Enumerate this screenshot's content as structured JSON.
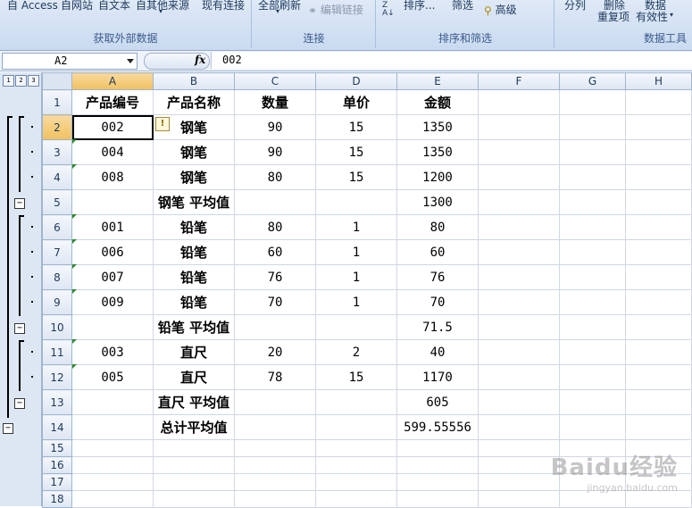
{
  "ribbon": {
    "external_data_items": [
      "自 Access",
      "自网站",
      "自文本",
      "自其他来源"
    ],
    "existing_connections": "现有连接",
    "refresh_all": "全部刷新",
    "edit_links": "编辑链接",
    "sort": "排序...",
    "filter": "筛选",
    "advanced": "高级",
    "split": "分列",
    "remove": "删除",
    "remove_dup": "重复项",
    "data": "数据",
    "validity": "有效性",
    "group_external": "获取外部数据",
    "group_connections": "连接",
    "group_sort_filter": "排序和筛选",
    "group_data_tools": "数据工具"
  },
  "formula_bar": {
    "name_box": "A2",
    "fx": "fx",
    "content": "002"
  },
  "outline": {
    "levels": [
      "1",
      "2",
      "3"
    ],
    "collapse_symbol": "−"
  },
  "columns": [
    "A",
    "B",
    "C",
    "D",
    "E",
    "F",
    "G",
    "H"
  ],
  "rows": [
    {
      "num": "1",
      "cells": [
        "产品编号",
        "产品名称",
        "数量",
        "单价",
        "金额",
        "",
        "",
        ""
      ]
    },
    {
      "num": "2",
      "cells": [
        "002",
        "钢笔",
        "90",
        "15",
        "1350",
        "",
        "",
        ""
      ]
    },
    {
      "num": "3",
      "cells": [
        "004",
        "钢笔",
        "90",
        "15",
        "1350",
        "",
        "",
        ""
      ]
    },
    {
      "num": "4",
      "cells": [
        "008",
        "钢笔",
        "80",
        "15",
        "1200",
        "",
        "",
        ""
      ]
    },
    {
      "num": "5",
      "cells": [
        "",
        "钢笔 平均值",
        "",
        "",
        "1300",
        "",
        "",
        ""
      ]
    },
    {
      "num": "6",
      "cells": [
        "001",
        "铅笔",
        "80",
        "1",
        "80",
        "",
        "",
        ""
      ]
    },
    {
      "num": "7",
      "cells": [
        "006",
        "铅笔",
        "60",
        "1",
        "60",
        "",
        "",
        ""
      ]
    },
    {
      "num": "8",
      "cells": [
        "007",
        "铅笔",
        "76",
        "1",
        "76",
        "",
        "",
        ""
      ]
    },
    {
      "num": "9",
      "cells": [
        "009",
        "铅笔",
        "70",
        "1",
        "70",
        "",
        "",
        ""
      ]
    },
    {
      "num": "10",
      "cells": [
        "",
        "铅笔 平均值",
        "",
        "",
        "71.5",
        "",
        "",
        ""
      ]
    },
    {
      "num": "11",
      "cells": [
        "003",
        "直尺",
        "20",
        "2",
        "40",
        "",
        "",
        ""
      ]
    },
    {
      "num": "12",
      "cells": [
        "005",
        "直尺",
        "78",
        "15",
        "1170",
        "",
        "",
        ""
      ]
    },
    {
      "num": "13",
      "cells": [
        "",
        "直尺 平均值",
        "",
        "",
        "605",
        "",
        "",
        ""
      ]
    },
    {
      "num": "14",
      "cells": [
        "",
        "总计平均值",
        "",
        "",
        "599.55556",
        "",
        "",
        ""
      ]
    },
    {
      "num": "15",
      "cells": [
        "",
        "",
        "",
        "",
        "",
        "",
        "",
        ""
      ]
    },
    {
      "num": "16",
      "cells": [
        "",
        "",
        "",
        "",
        "",
        "",
        "",
        ""
      ]
    },
    {
      "num": "17",
      "cells": [
        "",
        "",
        "",
        "",
        "",
        "",
        "",
        ""
      ]
    },
    {
      "num": "18",
      "cells": [
        "",
        "",
        "",
        "",
        "",
        "",
        "",
        ""
      ]
    }
  ],
  "watermark": {
    "brand": "Baidu经验",
    "url": "jingyan.baidu.com"
  }
}
